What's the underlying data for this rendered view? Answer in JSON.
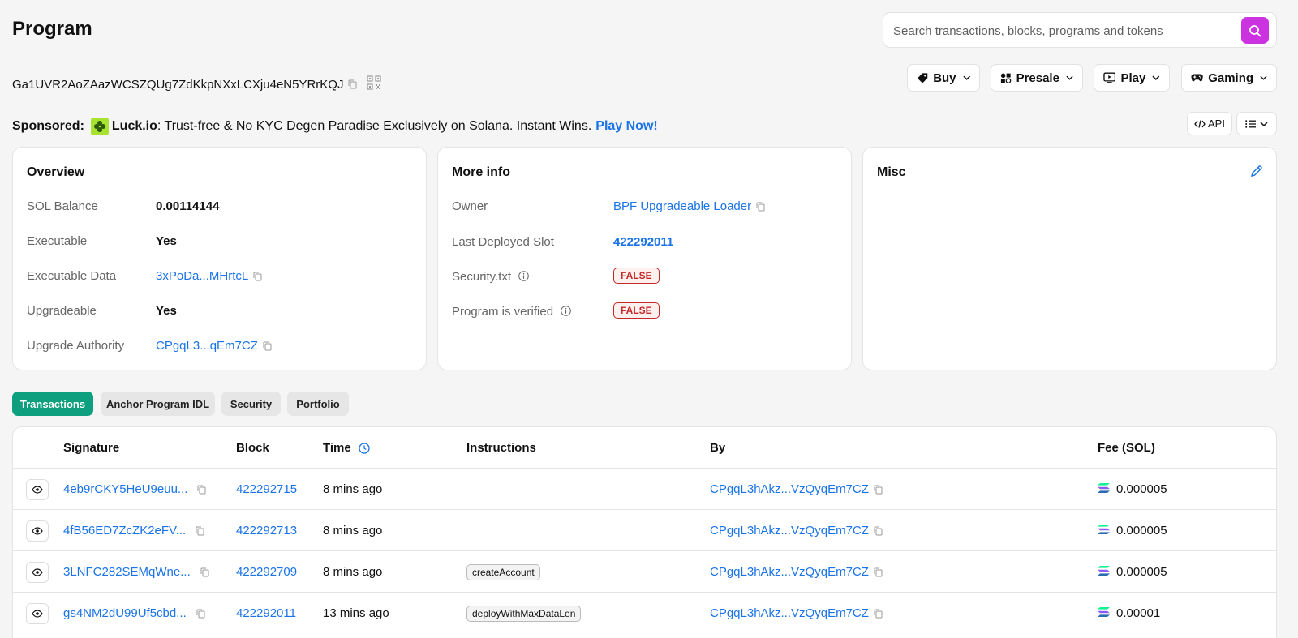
{
  "page": {
    "title": "Program"
  },
  "search": {
    "placeholder": "Search transactions, blocks, programs and tokens"
  },
  "address": "Ga1UVR2AoZAazWCSZQUg7ZdKkpNXxLCXju4eN5YRrKQJ",
  "nav": {
    "buy": "Buy",
    "presale": "Presale",
    "play": "Play",
    "gaming": "Gaming"
  },
  "sponsored": {
    "label": "Sponsored:",
    "brand": "Luck.io",
    "text": ": Trust-free & No KYC Degen Paradise Exclusively on Solana. Instant Wins.",
    "cta": "Play Now!"
  },
  "toolbar": {
    "api": "API"
  },
  "overview": {
    "title": "Overview",
    "rows": [
      {
        "label": "SOL Balance",
        "value": "0.00114144"
      },
      {
        "label": "Executable",
        "value": "Yes"
      },
      {
        "label": "Executable Data",
        "value": "3xPoDa...MHrtcL"
      },
      {
        "label": "Upgradeable",
        "value": "Yes"
      },
      {
        "label": "Upgrade Authority",
        "value": "CPgqL3...qEm7CZ"
      }
    ]
  },
  "more_info": {
    "title": "More info",
    "rows": [
      {
        "label": "Owner",
        "value": "BPF Upgradeable Loader"
      },
      {
        "label": "Last Deployed Slot",
        "value": "422292011"
      },
      {
        "label": "Security.txt",
        "value": "FALSE"
      },
      {
        "label": "Program is verified",
        "value": "FALSE"
      }
    ]
  },
  "misc": {
    "title": "Misc"
  },
  "tabs": [
    "Transactions",
    "Anchor Program IDL",
    "Security",
    "Portfolio"
  ],
  "table": {
    "headers": {
      "signature": "Signature",
      "block": "Block",
      "time": "Time",
      "instructions": "Instructions",
      "by": "By",
      "fee": "Fee (SOL)"
    },
    "rows": [
      {
        "signature": "4eb9rCKY5HeU9euu...",
        "block": "422292715",
        "time": "8 mins ago",
        "instruction": "",
        "by": "CPgqL3hAkz...VzQyqEm7CZ",
        "fee": "0.000005"
      },
      {
        "signature": "4fB56ED7ZcZK2eFV...",
        "block": "422292713",
        "time": "8 mins ago",
        "instruction": "",
        "by": "CPgqL3hAkz...VzQyqEm7CZ",
        "fee": "0.000005"
      },
      {
        "signature": "3LNFC282SEMqWne...",
        "block": "422292709",
        "time": "8 mins ago",
        "instruction": "createAccount",
        "by": "CPgqL3hAkz...VzQyqEm7CZ",
        "fee": "0.000005"
      },
      {
        "signature": "gs4NM2dU99Uf5cbd...",
        "block": "422292011",
        "time": "13 mins ago",
        "instruction": "deployWithMaxDataLen",
        "by": "CPgqL3hAkz...VzQyqEm7CZ",
        "fee": "0.00001"
      }
    ]
  },
  "colors": {
    "accent": "#1a73e8",
    "search_button": "#cc33e0",
    "active_tab": "#0e9f7e",
    "false_badge": "#c62828"
  }
}
